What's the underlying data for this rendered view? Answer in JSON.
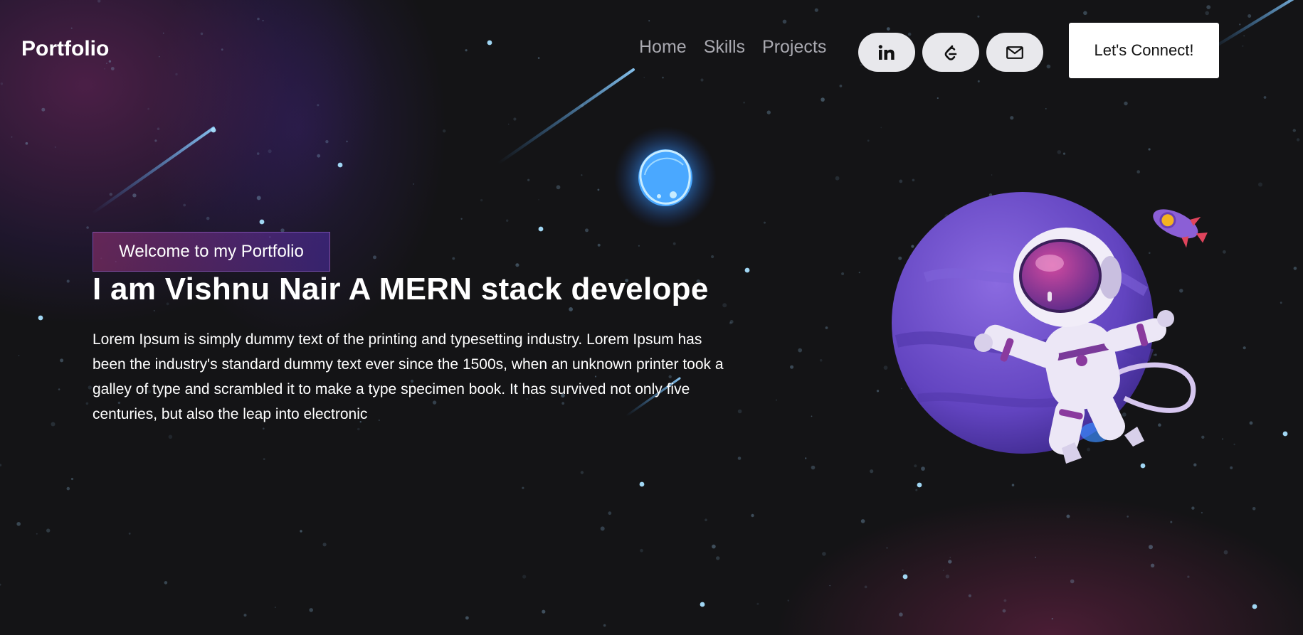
{
  "nav": {
    "brand": "Portfolio",
    "links": [
      "Home",
      "Skills",
      "Projects"
    ],
    "social_icons": [
      "linkedin-icon",
      "leetcode-icon",
      "mail-icon"
    ],
    "cta_label": "Let's Connect!"
  },
  "hero": {
    "tagline": "Welcome to my Portfolio",
    "headline": "I am Vishnu Nair A MERN stack develope",
    "intro": "Lorem Ipsum is simply dummy text of the printing and typesetting industry. Lorem Ipsum has been the industry's standard dummy text ever since the 1500s, when an unknown printer took a galley of type and scrambled it to make a type specimen book. It has survived not only five centuries, but also the leap into electronic"
  },
  "colors": {
    "background": "#141416",
    "tagline_gradient_start": "#aa367c",
    "tagline_gradient_end": "#4a2fbd",
    "planet": "#6a4bc4",
    "orb": "#4aa8ff"
  }
}
